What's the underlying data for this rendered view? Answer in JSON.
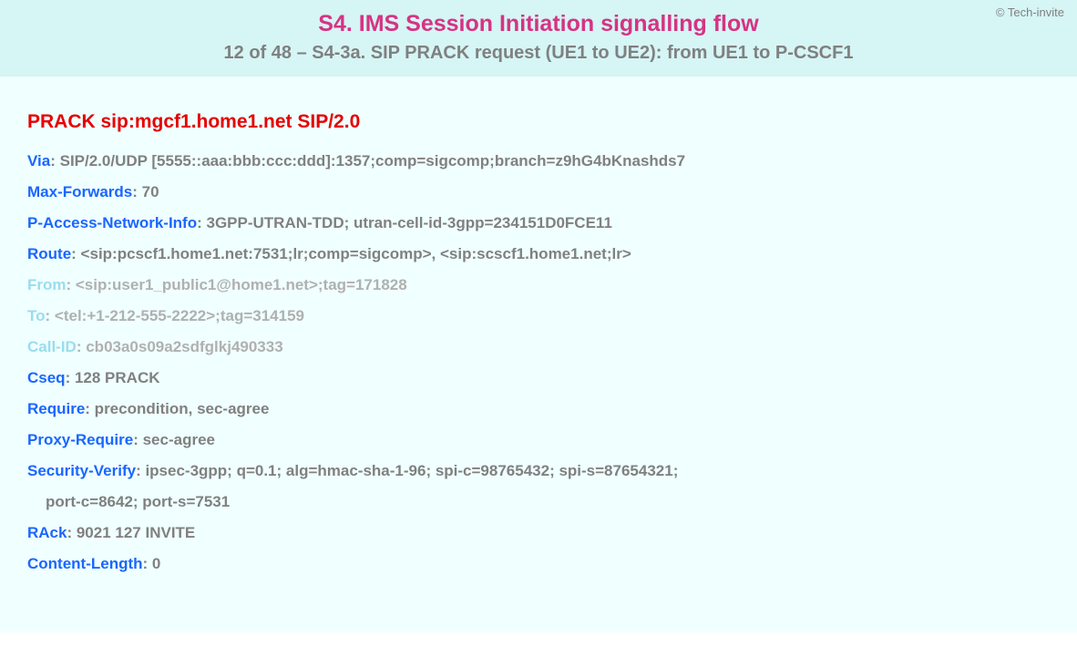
{
  "copyright": "© Tech-invite",
  "title": "S4. IMS Session Initiation signalling flow",
  "subtitle": "12 of 48 – S4-3a. SIP PRACK request (UE1 to UE2): from UE1 to P-CSCF1",
  "request_line": "PRACK sip:mgcf1.home1.net SIP/2.0",
  "headers": [
    {
      "name": "Via",
      "sep": ": ",
      "value": "SIP/2.0/UDP [5555::aaa:bbb:ccc:ddd]:1357;comp=sigcomp;branch=z9hG4bKnashds7",
      "muted": false
    },
    {
      "name": "Max-Forwards",
      "sep": ": ",
      "value": "70",
      "muted": false
    },
    {
      "name": "P-Access-Network-Info",
      "sep": ": ",
      "value": "3GPP-UTRAN-TDD; utran-cell-id-3gpp=234151D0FCE11",
      "muted": false
    },
    {
      "name": "Route",
      "sep": ": ",
      "value": "<sip:pcscf1.home1.net:7531;lr;comp=sigcomp>, <sip:scscf1.home1.net;lr>",
      "muted": false
    },
    {
      "name": "From",
      "sep": ": ",
      "value": "<sip:user1_public1@home1.net>;tag=171828",
      "muted": true
    },
    {
      "name": "To",
      "sep": ": ",
      "value": "<tel:+1-212-555-2222>;tag=314159",
      "muted": true
    },
    {
      "name": "Call-ID",
      "sep": ": ",
      "value": "cb03a0s09a2sdfglkj490333",
      "muted": true
    },
    {
      "name": "Cseq",
      "sep": ": ",
      "value": "128 PRACK",
      "muted": false
    },
    {
      "name": "Require",
      "sep": ": ",
      "value": "precondition, sec-agree",
      "muted": false
    },
    {
      "name": "Proxy-Require",
      "sep": ": ",
      "value": "sec-agree",
      "muted": false
    },
    {
      "name": "Security-Verify",
      "sep": ": ",
      "value": "ipsec-3gpp; q=0.1; alg=hmac-sha-1-96; spi-c=98765432; spi-s=87654321;",
      "muted": false,
      "continuation": "port-c=8642; port-s=7531"
    },
    {
      "name": "RAck",
      "sep": ": ",
      "value": "9021 127 INVITE",
      "muted": false
    },
    {
      "name": "Content-Length",
      "sep": ": ",
      "value": "0",
      "muted": false
    }
  ]
}
